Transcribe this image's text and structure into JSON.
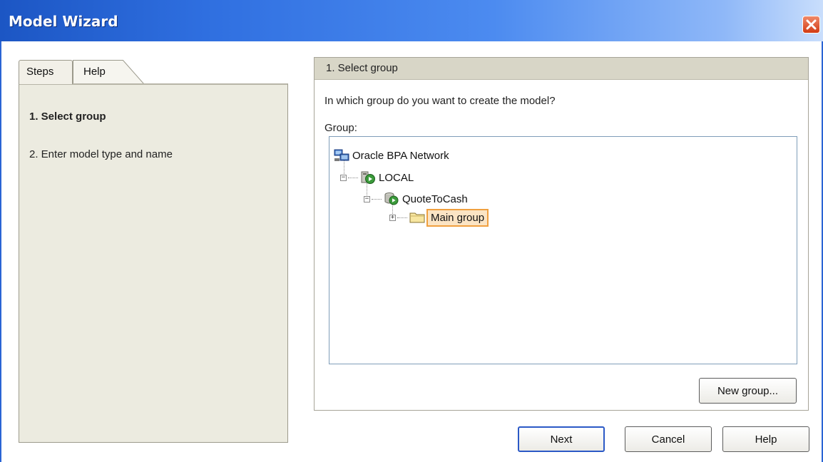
{
  "window": {
    "title": "Model Wizard",
    "close_icon": "close-icon",
    "title_bar_color": "#2f6fe0",
    "close_color": "#d23b14"
  },
  "sidebar": {
    "tabs": [
      {
        "label": "Steps",
        "active": true
      },
      {
        "label": "Help",
        "active": false
      }
    ],
    "steps": [
      {
        "label": "1. Select group",
        "current": true
      },
      {
        "label": "2. Enter model type and name",
        "current": false
      }
    ]
  },
  "main": {
    "header": "1. Select group",
    "question": "In which group do you want to create the model?",
    "group_label": "Group:",
    "tree": [
      {
        "label": "Oracle BPA Network",
        "icon": "network-icon",
        "level": 0,
        "toggle": ""
      },
      {
        "label": "LOCAL",
        "icon": "server-icon",
        "level": 1,
        "toggle": "−"
      },
      {
        "label": "QuoteToCash",
        "icon": "database-icon",
        "level": 2,
        "toggle": "−"
      },
      {
        "label": "Main group",
        "icon": "folder-icon",
        "level": 3,
        "toggle": "+",
        "selected": true
      }
    ],
    "new_group_button": "New group..."
  },
  "footer": {
    "next": "Next",
    "cancel": "Cancel",
    "help": "Help"
  },
  "colors": {
    "selection_border": "#f0a040",
    "selection_fill": "#fbe4c4",
    "panel_bg": "#ecebe0",
    "header_bg": "#d8d6c7"
  }
}
